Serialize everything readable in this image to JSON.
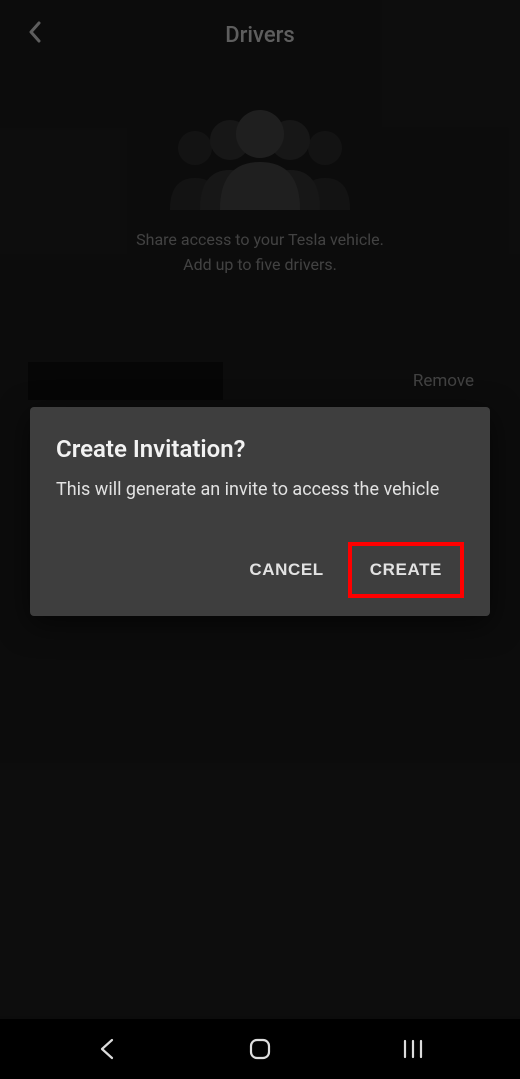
{
  "header": {
    "title": "Drivers"
  },
  "hero": {
    "line1": "Share access to your Tesla vehicle.",
    "line2": "Add up to five drivers."
  },
  "drivers": [
    {
      "remove_label": "Remove"
    }
  ],
  "dialog": {
    "title": "Create Invitation?",
    "body": "This will generate an invite to access the vehicle",
    "cancel_label": "CANCEL",
    "create_label": "CREATE"
  }
}
